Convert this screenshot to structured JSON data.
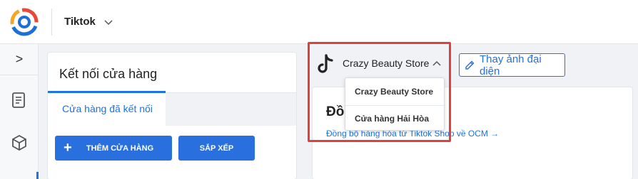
{
  "header": {
    "platform_label": "Tiktok",
    "icons": {
      "logo": "app-logo-icon",
      "platform_dropdown": "chevron-down-icon"
    }
  },
  "sidebar": {
    "toggle_glyph": ">",
    "icons": [
      "collapse-toggle-icon",
      "document-icon",
      "package-icon"
    ]
  },
  "left_panel": {
    "title": "Kết nối cửa hàng",
    "tabs": [
      {
        "label": "Cửa hàng đã kết nối",
        "active": true
      }
    ],
    "buttons": {
      "add_plus": "+",
      "add_label": "THÊM CỬA HÀNG",
      "sort_label": "SẮP XẾP"
    }
  },
  "store_selector": {
    "selected": "Crazy Beauty Store",
    "icon": "tiktok-icon",
    "change_avatar_label": "Thay ảnh đại diện",
    "options": [
      "Crazy Beauty Store",
      "Cửa hàng Hải Hòa"
    ]
  },
  "right_panel": {
    "heading": "Đồn",
    "sync_link": "Đồng bộ hàng hóa từ Tiktok Shop về OCM →"
  },
  "colors": {
    "accent": "#2a6fde",
    "link": "#1a73e8",
    "highlight": "#e0403a",
    "background": "#f0f2f5"
  }
}
